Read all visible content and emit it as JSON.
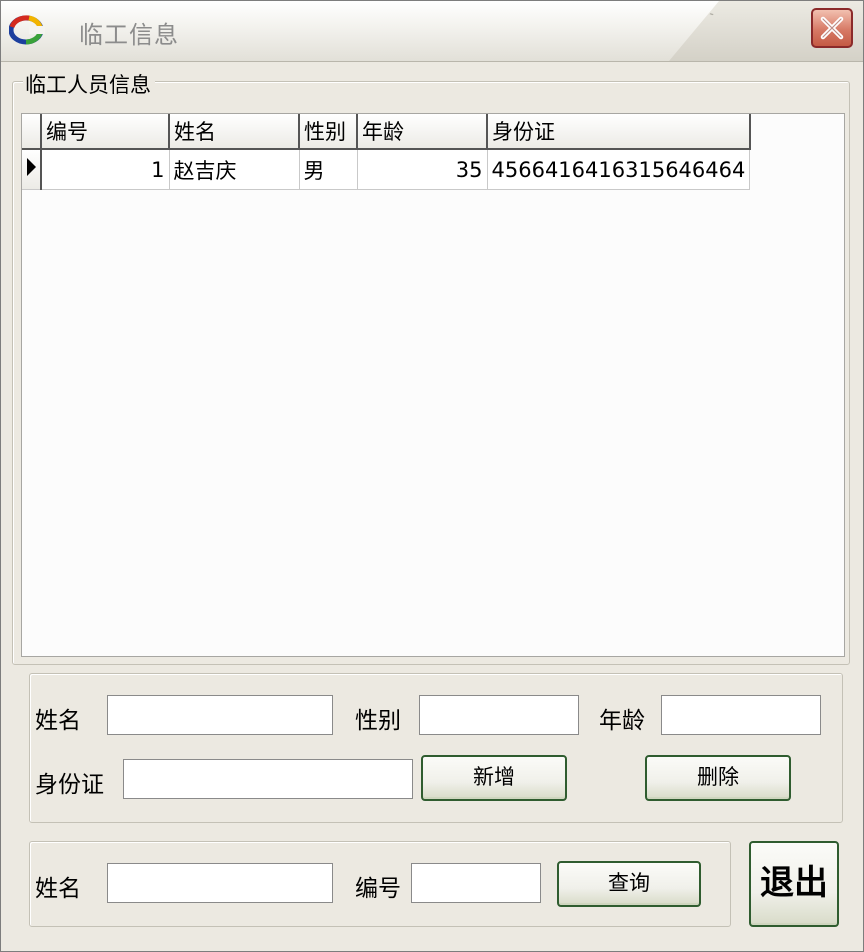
{
  "window": {
    "title": "临工信息"
  },
  "group": {
    "legend": "临工人员信息"
  },
  "grid": {
    "columns": [
      "编号",
      "姓名",
      "性别",
      "年龄",
      "身份证"
    ],
    "rows": [
      {
        "id": "1",
        "name": "赵吉庆",
        "gender": "男",
        "age": "35",
        "id_card": "4566416416315646464"
      }
    ]
  },
  "form": {
    "name_label": "姓名",
    "gender_label": "性别",
    "age_label": "年龄",
    "idcard_label": "身份证",
    "add_button": "新增",
    "delete_button": "删除"
  },
  "query": {
    "name_label": "姓名",
    "id_label": "编号",
    "query_button": "查询"
  },
  "exit_button": "退出"
}
